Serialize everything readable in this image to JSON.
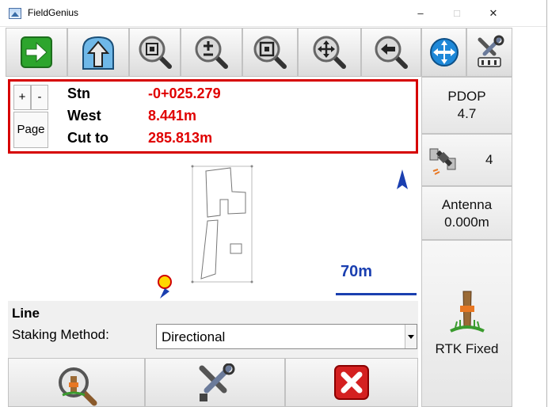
{
  "window": {
    "title": "FieldGenius",
    "minimize": "–",
    "maximize": "□",
    "close": "✕"
  },
  "toolbar": {
    "buttons": [
      {
        "name": "forward-arrow-icon"
      },
      {
        "name": "up-arrow-home-icon"
      },
      {
        "name": "zoom-extents-icon"
      },
      {
        "name": "zoom-in-out-icon"
      },
      {
        "name": "zoom-window-icon"
      },
      {
        "name": "pan-icon"
      },
      {
        "name": "zoom-previous-icon"
      },
      {
        "name": "globe-icon"
      },
      {
        "name": "settings-tools-icon"
      }
    ]
  },
  "info": {
    "plus": "+",
    "minus": "-",
    "page": "Page",
    "rows": [
      {
        "label": "Stn",
        "value": "-0+025.279"
      },
      {
        "label": "West",
        "value": "8.441m"
      },
      {
        "label": "Cut to",
        "value": "285.813m"
      }
    ]
  },
  "status": {
    "pdop_label": "PDOP",
    "pdop_value": "4.7",
    "satellites": "4",
    "antenna_label": "Antenna",
    "antenna_value": "0.000m",
    "rtk": "RTK Fixed"
  },
  "map": {
    "scale": "70m",
    "north_icon": "north-arrow-icon"
  },
  "panel": {
    "title": "Line",
    "method_label": "Staking Method:",
    "method_value": "Directional"
  },
  "bottom": {
    "buttons": [
      {
        "name": "inspect-icon"
      },
      {
        "name": "tools-icon"
      },
      {
        "name": "cancel-icon"
      }
    ]
  },
  "colors": {
    "accent_red": "#e00000",
    "frame_red": "#d60000",
    "scale_blue": "#1a3fb0"
  }
}
